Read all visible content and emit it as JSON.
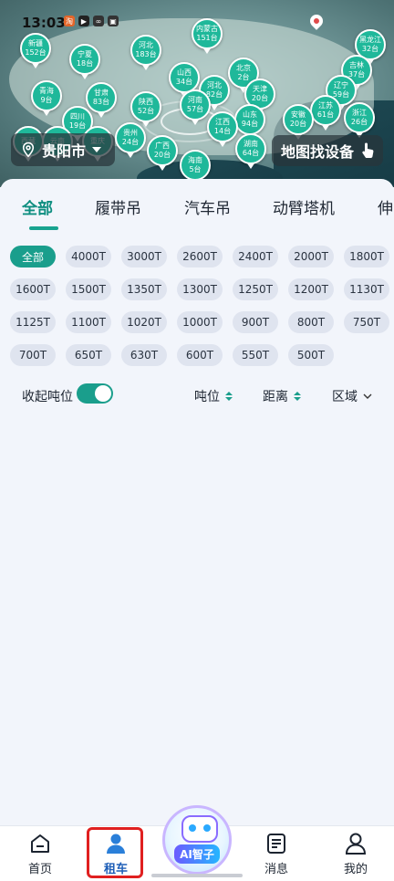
{
  "status_bar": {
    "time": "13:03"
  },
  "map": {
    "provinces": [
      {
        "name": "新疆",
        "count": "152台"
      },
      {
        "name": "宁夏",
        "count": "18台"
      },
      {
        "name": "河北",
        "count": "183台"
      },
      {
        "name": "内蒙古",
        "count": "151台"
      },
      {
        "name": "黑龙江",
        "count": "32台"
      },
      {
        "name": "山西",
        "count": "34台"
      },
      {
        "name": "北京",
        "count": "2台"
      },
      {
        "name": "吉林",
        "count": "37台"
      },
      {
        "name": "青海",
        "count": "9台"
      },
      {
        "name": "甘肃",
        "count": "83台"
      },
      {
        "name": "河北",
        "count": "82台"
      },
      {
        "name": "天津",
        "count": "20台"
      },
      {
        "name": "辽宁",
        "count": "59台"
      },
      {
        "name": "陕西",
        "count": "52台"
      },
      {
        "name": "河南",
        "count": "57台"
      },
      {
        "name": "四川",
        "count": "19台"
      },
      {
        "name": "江苏",
        "count": "61台"
      },
      {
        "name": "浙江",
        "count": "26台"
      },
      {
        "name": "山东",
        "count": "94台"
      },
      {
        "name": "安徽",
        "count": "20台"
      },
      {
        "name": "江西",
        "count": "14台"
      },
      {
        "name": "贵州",
        "count": "24台"
      },
      {
        "name": "西藏",
        "count": ""
      },
      {
        "name": "云南",
        "count": ""
      },
      {
        "name": "重庆",
        "count": ""
      },
      {
        "name": "广西",
        "count": "20台"
      },
      {
        "name": "湖南",
        "count": "64台"
      },
      {
        "name": "海南",
        "count": "5台"
      }
    ],
    "city": "贵阳市",
    "map_search_label": "地图找设备"
  },
  "tabs": [
    "全部",
    "履带吊",
    "汽车吊",
    "动臂塔机",
    "伸"
  ],
  "tonnage_chips": [
    "全部",
    "4000T",
    "3000T",
    "2600T",
    "2400T",
    "2000T",
    "1800T",
    "1600T",
    "1500T",
    "1350T",
    "1300T",
    "1250T",
    "1200T",
    "1130T",
    "1125T",
    "1100T",
    "1020T",
    "1000T",
    "900T",
    "800T",
    "750T",
    "700T",
    "650T",
    "630T",
    "600T",
    "550T",
    "500T"
  ],
  "filters": {
    "collapse_label": "收起吨位",
    "collapse_on": true,
    "sort_tonnage": "吨位",
    "sort_distance": "距离",
    "region": "区域"
  },
  "bottom_nav": {
    "home": "首页",
    "rent": "租车",
    "ai": "AI智子",
    "messages": "消息",
    "mine": "我的"
  },
  "colors": {
    "accent": "#1a9e8c",
    "nav_active": "#1f5fb8",
    "highlight": "#e02020"
  }
}
